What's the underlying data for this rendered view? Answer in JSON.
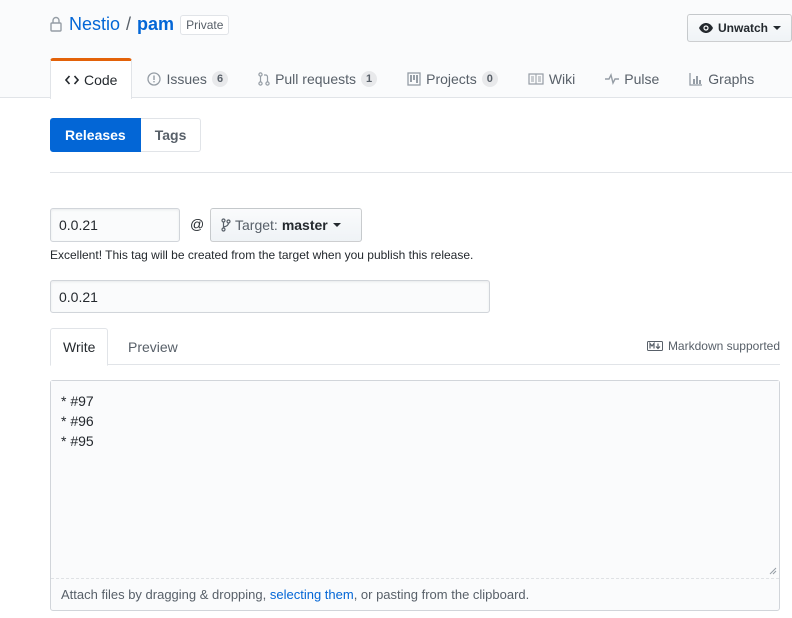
{
  "repo": {
    "owner": "Nestio",
    "separator": "/",
    "name": "pam",
    "visibility": "Private"
  },
  "watch_button": {
    "label": "Unwatch"
  },
  "tabs": [
    {
      "label": "Code",
      "icon": "code-icon",
      "selected": true
    },
    {
      "label": "Issues",
      "icon": "issue-icon",
      "count": "6"
    },
    {
      "label": "Pull requests",
      "icon": "pull-request-icon",
      "count": "1"
    },
    {
      "label": "Projects",
      "icon": "project-icon",
      "count": "0"
    },
    {
      "label": "Wiki",
      "icon": "book-icon"
    },
    {
      "label": "Pulse",
      "icon": "pulse-icon"
    },
    {
      "label": "Graphs",
      "icon": "graph-icon"
    }
  ],
  "subnav": {
    "releases": "Releases",
    "tags": "Tags"
  },
  "release_form": {
    "tag_value": "0.0.21",
    "at": "@",
    "target_label": "Target:",
    "target_branch": "master",
    "hint": "Excellent! This tag will be created from the target when you publish this release.",
    "title_value": "0.0.21",
    "write_tab": "Write",
    "preview_tab": "Preview",
    "markdown_note": "Markdown supported",
    "body_text": "* #97\n* #96\n* #95",
    "attach_prefix": "Attach files by dragging & dropping, ",
    "attach_link": "selecting them",
    "attach_suffix": ", or pasting from the clipboard."
  },
  "colors": {
    "link": "#0366d6",
    "selected_tab_accent": "#e36209",
    "primary_button": "#0366d6"
  }
}
